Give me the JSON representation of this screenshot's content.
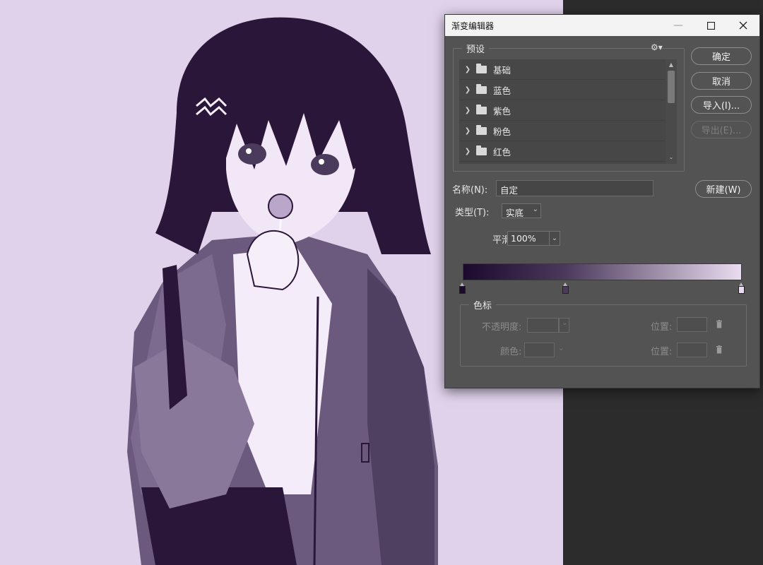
{
  "dialog": {
    "title": "渐变编辑器",
    "window_controls": {
      "minimize": "—",
      "maximize": "☐",
      "close": "✕"
    }
  },
  "presets": {
    "title": "预设",
    "gear_icon": "⚙▾",
    "items": [
      {
        "label": "基础"
      },
      {
        "label": "蓝色"
      },
      {
        "label": "紫色"
      },
      {
        "label": "粉色"
      },
      {
        "label": "红色"
      }
    ]
  },
  "buttons": {
    "ok": "确定",
    "cancel": "取消",
    "import": "导入(I)...",
    "export": "导出(E)...",
    "new": "新建(W)"
  },
  "name": {
    "label": "名称(N):",
    "value": "自定"
  },
  "type": {
    "label": "类型(T):",
    "value": "实底"
  },
  "smoothness": {
    "label": "平滑度:",
    "value": "100%"
  },
  "gradient": {
    "colors": [
      "#1c0a2e",
      "#4b3a5c",
      "#eadcf0"
    ],
    "stops": [
      {
        "position": 0,
        "color": "#1c0a2e"
      },
      {
        "position": 37,
        "color": "#4b3a5c"
      },
      {
        "position": 100,
        "color": "#eadcf0"
      }
    ]
  },
  "color_stops": {
    "title": "色标",
    "opacity_label": "不透明度:",
    "color_label": "颜色:",
    "location_label_1": "位置:",
    "location_label_2": "位置:"
  },
  "canvas": {
    "background": "#e0d2eb",
    "ink": "#2a1638"
  }
}
